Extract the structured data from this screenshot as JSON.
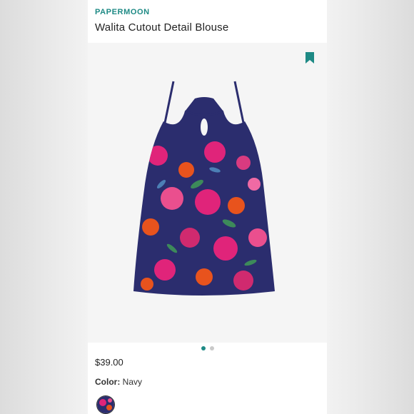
{
  "product": {
    "brand": "PAPERMOON",
    "title": "Walita Cutout Detail Blouse",
    "price": "$39.00",
    "color_label": "Color:",
    "color_value": "Navy"
  },
  "gallery": {
    "image_count": 2,
    "active_index": 0
  },
  "colors": {
    "accent": "#1e8a85",
    "navy": "#2b2d6e",
    "pink": "#e0247a",
    "orange": "#e8531d"
  },
  "icons": {
    "bookmark": "bookmark-icon"
  }
}
